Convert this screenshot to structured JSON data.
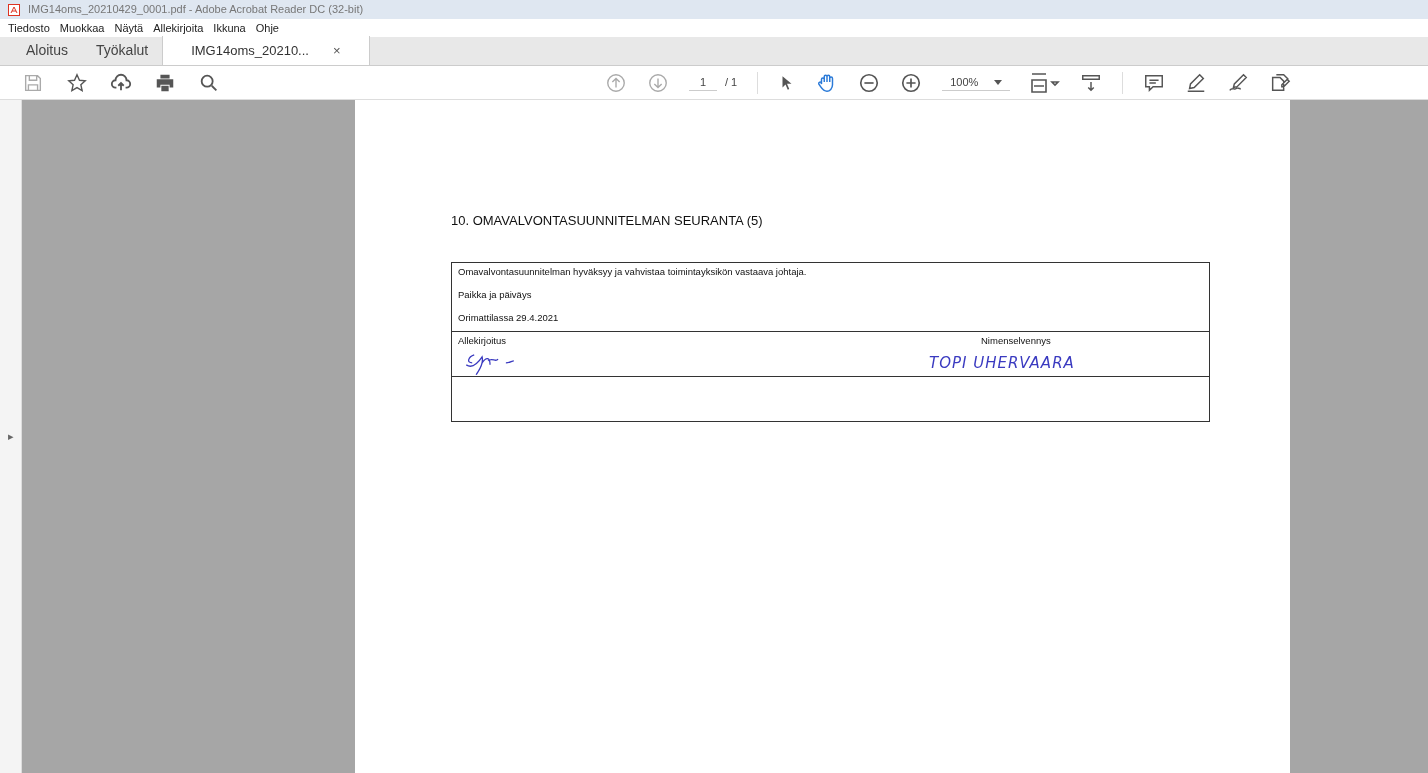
{
  "window": {
    "title": "IMG14oms_20210429_0001.pdf - Adobe Acrobat Reader DC (32-bit)"
  },
  "menu": [
    "Tiedosto",
    "Muokkaa",
    "Näytä",
    "Allekirjoita",
    "Ikkuna",
    "Ohje"
  ],
  "tabs": [
    {
      "label": "Aloitus",
      "selected": false
    },
    {
      "label": "Työkalut",
      "selected": false
    },
    {
      "label": "IMG14oms_20210...",
      "selected": true
    }
  ],
  "close_glyph": "×",
  "page_nav": {
    "current": "1",
    "total": "/ 1"
  },
  "zoom": "100%",
  "side_toggle": "▸",
  "document": {
    "heading": "10. OMAVALVONTASUUNNITELMAN SEURANTA (5)",
    "statement": "Omavalvontasuunnitelman hyväksyy ja vahvistaa toimintayksikön vastaava johtaja.",
    "place_label": "Paikka ja päiväys",
    "place_value": "Orimattilassa 29.4.2021",
    "signature_label": "Allekirjoitus",
    "name_label": "Nimenselvennys",
    "name_value": "TOPI UHERVAARA"
  }
}
